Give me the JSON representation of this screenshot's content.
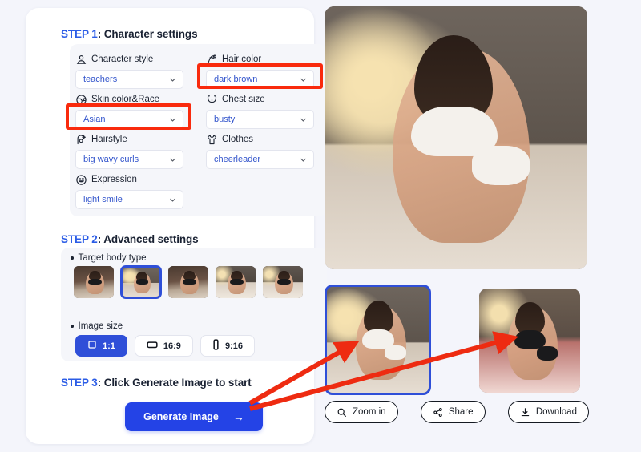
{
  "theme": {
    "accent_blue": "#2443e6",
    "step_label_blue": "#2b5ce6",
    "select_text_blue": "#3355cc",
    "highlight_red": "#f92a0d",
    "page_bg": "#f4f5fb",
    "panel_bg": "#f5f6fa"
  },
  "step1": {
    "num": "STEP 1",
    "separator": ":",
    "title": " Character settings",
    "fields": [
      {
        "icon": "person-style-icon",
        "label": "Character style",
        "value": "teachers",
        "highlighted": false
      },
      {
        "icon": "hair-color-icon",
        "label": "Hair color",
        "value": "dark brown",
        "highlighted": true
      },
      {
        "icon": "skin-globe-icon",
        "label": "Skin color&Race",
        "value": "Asian",
        "highlighted": true
      },
      {
        "icon": "chest-size-icon",
        "label": "Chest size",
        "value": "busty",
        "highlighted": false
      },
      {
        "icon": "hairstyle-icon",
        "label": "Hairstyle",
        "value": "big wavy curls",
        "highlighted": false
      },
      {
        "icon": "clothes-shirt-icon",
        "label": "Clothes",
        "value": "cheerleader",
        "highlighted": false
      },
      {
        "icon": "expression-icon",
        "label": "Expression",
        "value": "light smile",
        "highlighted": false
      }
    ]
  },
  "step2": {
    "num": "STEP 2",
    "separator": ":",
    "title": " Advanced settings",
    "body_type_label": "Target body type",
    "body_types": [
      {
        "name": "body-type-1",
        "selected": false
      },
      {
        "name": "body-type-2",
        "selected": true
      },
      {
        "name": "body-type-3",
        "selected": false
      },
      {
        "name": "body-type-4",
        "selected": false
      },
      {
        "name": "body-type-5",
        "selected": false
      }
    ],
    "image_size_label": "Image size",
    "image_sizes": [
      {
        "label": "1:1",
        "icon": "square-icon",
        "active": true
      },
      {
        "label": "16:9",
        "icon": "landscape-icon",
        "active": false
      },
      {
        "label": "9:16",
        "icon": "portrait-icon",
        "active": false
      }
    ]
  },
  "step3": {
    "num": "STEP 3",
    "separator": ":",
    "title": " Click Generate Image to start",
    "generate_label": "Generate Image",
    "generate_arrow": "→"
  },
  "result": {
    "preview_name": "generated-image-preview",
    "thumbs": [
      {
        "name": "result-thumb-white-outfit",
        "selected": true
      },
      {
        "name": "result-thumb-black-outfit",
        "selected": false
      }
    ],
    "actions": [
      {
        "label": "Zoom in",
        "icon": "magnifier-icon"
      },
      {
        "label": "Share",
        "icon": "share-icon"
      },
      {
        "label": "Download",
        "icon": "download-icon"
      }
    ]
  },
  "annotations": {
    "arrow_color": "#ee2b11",
    "arrows": [
      {
        "name": "arrow-to-result-thumb"
      },
      {
        "name": "arrow-to-alt-result"
      }
    ]
  }
}
